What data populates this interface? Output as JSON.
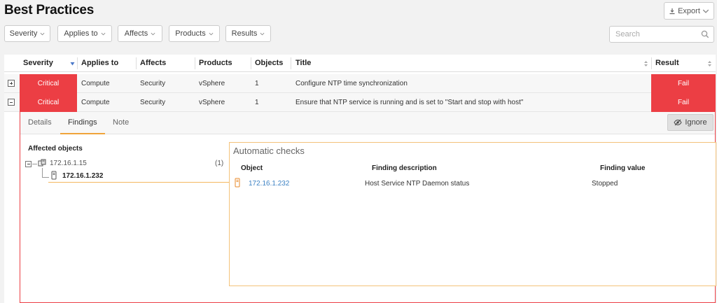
{
  "header": {
    "title": "Best Practices",
    "export_label": "Export"
  },
  "filters": [
    {
      "label": "Severity"
    },
    {
      "label": "Applies to"
    },
    {
      "label": "Affects"
    },
    {
      "label": "Products"
    },
    {
      "label": "Results"
    }
  ],
  "search": {
    "placeholder": "Search",
    "value": ""
  },
  "table": {
    "columns": [
      "Severity",
      "Applies to",
      "Affects",
      "Products",
      "Objects",
      "Title",
      "Result"
    ],
    "rows": [
      {
        "severity": "Critical",
        "applies_to": "Compute",
        "affects": "Security",
        "products": "vSphere",
        "objects": "1",
        "title": "Configure NTP time synchronization",
        "result": "Fail"
      },
      {
        "severity": "Critical",
        "applies_to": "Compute",
        "affects": "Security",
        "products": "vSphere",
        "objects": "1",
        "title": "Ensure that NTP service is running and is set to \"Start and stop with host\"",
        "result": "Fail"
      }
    ]
  },
  "detail": {
    "tabs": [
      "Details",
      "Findings",
      "Note"
    ],
    "active_tab": "Findings",
    "ignore_label": "Ignore",
    "affected_objects_title": "Affected objects",
    "tree": {
      "parent": {
        "label": "172.16.1.15",
        "count": "(1)"
      },
      "child": {
        "label": "172.16.1.232"
      }
    },
    "automatic_checks": {
      "title": "Automatic checks",
      "columns": [
        "Object",
        "Finding description",
        "Finding value"
      ],
      "rows": [
        {
          "object": "172.16.1.232",
          "description": "Host Service NTP Daemon status",
          "value": "Stopped"
        }
      ]
    }
  },
  "colors": {
    "critical": "#ec3e44",
    "accent": "#f0a43a",
    "link": "#3d82c4"
  }
}
